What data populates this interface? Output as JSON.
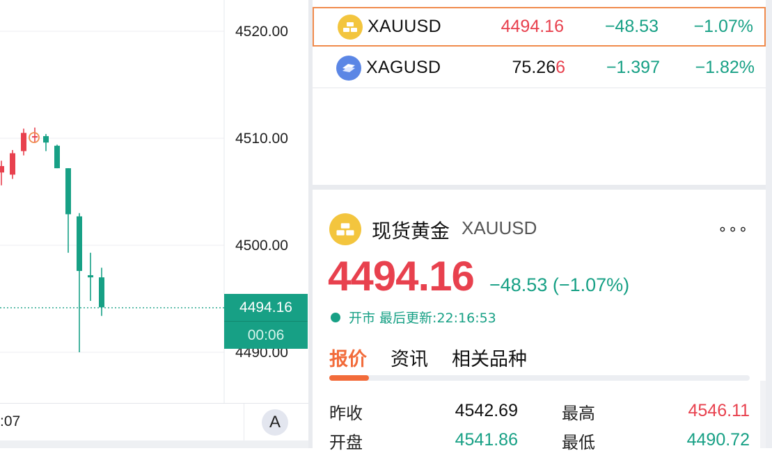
{
  "colors": {
    "up": "#e8414e",
    "down": "#17a085",
    "accent": "#f26b3a",
    "highlight_border": "#f08a4b"
  },
  "chart": {
    "y_axis_labels": [
      "4520.00",
      "4510.00",
      "4500.00",
      "4490.00"
    ],
    "current_price": "4494.16",
    "countdown": "00:06",
    "time_label": ":07",
    "auto_button": "A",
    "candles": [
      {
        "o": 4506.8,
        "h": 4507.9,
        "l": 4505.6,
        "c": 4507.4
      },
      {
        "o": 4506.6,
        "h": 4508.9,
        "l": 4506.2,
        "c": 4508.6
      },
      {
        "o": 4508.8,
        "h": 4510.9,
        "l": 4508.4,
        "c": 4510.5
      },
      {
        "o": 4510.2,
        "h": 4511.0,
        "l": 4509.6,
        "c": 4510.2
      },
      {
        "o": 4510.2,
        "h": 4510.4,
        "l": 4508.8,
        "c": 4509.6
      },
      {
        "o": 4509.3,
        "h": 4509.4,
        "l": 4507.2,
        "c": 4507.2
      },
      {
        "o": 4507.2,
        "h": 4507.2,
        "l": 4499.3,
        "c": 4502.9
      },
      {
        "o": 4502.7,
        "h": 4503.0,
        "l": 4490.0,
        "c": 4497.6
      },
      {
        "o": 4497.2,
        "h": 4499.3,
        "l": 4494.8,
        "c": 4497.0
      },
      {
        "o": 4497.0,
        "h": 4497.9,
        "l": 4493.4,
        "c": 4494.2
      }
    ]
  },
  "watchlist": [
    {
      "symbol": "XAUUSD",
      "icon": "gold-bars-icon",
      "last": "4494.16",
      "last_suffix": "",
      "change": "−48.53",
      "pct": "−1.07%",
      "selected": true
    },
    {
      "symbol": "XAGUSD",
      "icon": "silver-bars-icon",
      "last": "75.26",
      "last_suffix": "6",
      "change": "−1.397",
      "pct": "−1.82%",
      "selected": false
    }
  ],
  "detail": {
    "name": "现货黄金",
    "code": "XAUUSD",
    "more": "∘∘∘",
    "price": "4494.16",
    "change": "−48.53 (−1.07%)",
    "status": "开市 最后更新:22:16:53",
    "tabs": {
      "quote": "报价",
      "news": "资讯",
      "related": "相关品种"
    },
    "quotes": {
      "prev_close_label": "昨收",
      "prev_close": "4542.69",
      "high_label": "最高",
      "high": "4546.11",
      "open_label": "开盘",
      "open": "4541.86",
      "low_label": "最低",
      "low": "4490.72"
    }
  }
}
